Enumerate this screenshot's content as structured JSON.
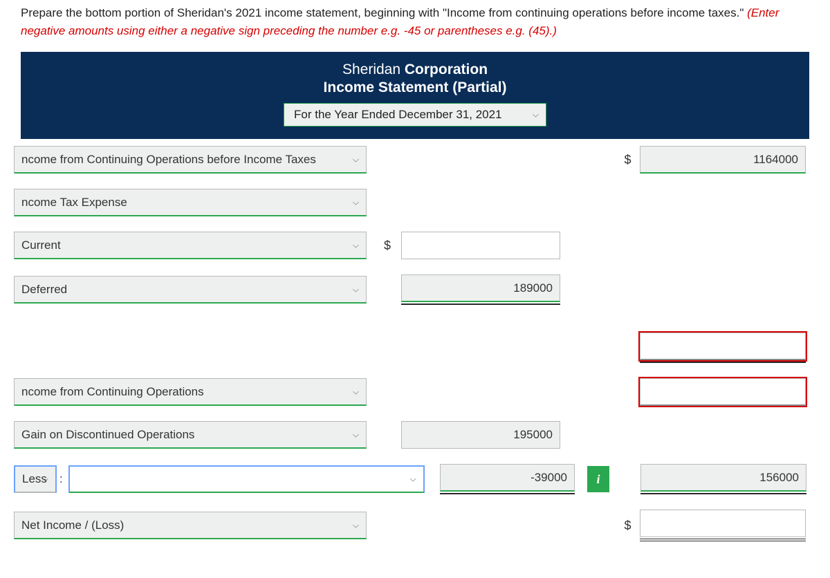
{
  "instructions": {
    "black": "Prepare the bottom portion of Sheridan's 2021 income statement, beginning with \"Income from continuing operations before income taxes.\" ",
    "red": "(Enter negative amounts using either a negative sign preceding the number e.g. -45 or parentheses e.g. (45).)"
  },
  "header": {
    "company_pre": "Sheridan ",
    "company_bold": "Corporation",
    "subtitle": "Income Statement (Partial)",
    "period": "For the Year Ended December 31, 2021"
  },
  "rows": {
    "r1": {
      "label": "ncome from Continuing Operations before Income Taxes",
      "dollar": "$",
      "right_value": "1164000"
    },
    "r2": {
      "label": "ncome Tax Expense"
    },
    "r3": {
      "label": "Current",
      "dollar": "$",
      "mid_value": ""
    },
    "r4": {
      "label": "Deferred",
      "mid_value": "189000"
    },
    "r5_blank": {
      "right_value": ""
    },
    "r6": {
      "label": "ncome from Continuing Operations",
      "right_value": ""
    },
    "r7": {
      "label": "Gain on Discontinued Operations",
      "mid_value": "195000"
    },
    "r8": {
      "less_label": "Less",
      "colon": ":",
      "inline_label": "",
      "mid_value": "-39000",
      "right_value": "156000"
    },
    "r9": {
      "label": "Net Income / (Loss)",
      "dollar": "$",
      "right_value": ""
    }
  }
}
